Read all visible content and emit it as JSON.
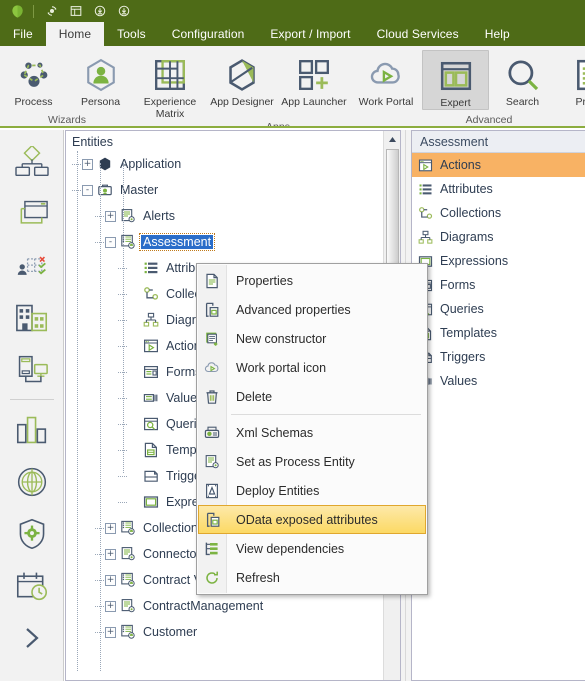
{
  "titlebar": {
    "icons": [
      "app-logo-icon",
      "refresh-circle-icon",
      "window-layout-icon",
      "download-circle-icon",
      "download-circle-alt-icon"
    ]
  },
  "menu": {
    "tabs": [
      {
        "label": "File",
        "active": false
      },
      {
        "label": "Home",
        "active": true
      },
      {
        "label": "Tools",
        "active": false
      },
      {
        "label": "Configuration",
        "active": false
      },
      {
        "label": "Export / Import",
        "active": false
      },
      {
        "label": "Cloud Services",
        "active": false
      },
      {
        "label": "Help",
        "active": false
      }
    ]
  },
  "ribbon": {
    "groups": [
      {
        "label": "Wizards",
        "items": [
          {
            "label": "Process",
            "icon": "process-nodes-icon",
            "selected": false
          },
          {
            "label": "Persona",
            "icon": "persona-icon",
            "selected": false
          }
        ]
      },
      {
        "label": "Apps",
        "items": [
          {
            "label": "Experience Matrix",
            "icon": "experience-matrix-icon",
            "selected": false
          },
          {
            "label": "App Designer",
            "icon": "app-designer-icon",
            "selected": false
          },
          {
            "label": "App Launcher",
            "icon": "app-launcher-icon",
            "selected": false
          },
          {
            "label": "Work Portal",
            "icon": "work-portal-icon",
            "selected": false
          }
        ]
      },
      {
        "label": "Advanced",
        "items": [
          {
            "label": "Expert",
            "icon": "expert-icon",
            "selected": true
          },
          {
            "label": "Search",
            "icon": "search-icon",
            "selected": false
          }
        ]
      },
      {
        "label": "",
        "items": [
          {
            "label": "Prope",
            "icon": "properties-doc-icon",
            "selected": false
          }
        ]
      }
    ]
  },
  "rail": {
    "items": [
      {
        "name": "org-chart-icon"
      },
      {
        "name": "window-forms-icon"
      },
      {
        "name": "user-tasks-icon"
      },
      {
        "name": "buildings-icon"
      },
      {
        "name": "devices-icon"
      },
      {
        "divider": true
      },
      {
        "name": "bar-chart-icon"
      },
      {
        "name": "globe-icon"
      },
      {
        "name": "shield-gear-icon"
      },
      {
        "name": "calendar-clock-icon"
      },
      {
        "name": "expand-chevron-icon"
      }
    ]
  },
  "tree": {
    "title": "Entities",
    "nodes": [
      {
        "label": "Application",
        "depth": 0,
        "expander": "+",
        "icon": "hexagon-solid-icon",
        "selected": false
      },
      {
        "label": "Master",
        "depth": 0,
        "expander": "-",
        "icon": "briefcase-icon",
        "selected": false
      },
      {
        "label": "Alerts",
        "depth": 1,
        "expander": "+",
        "icon": "entity-alert-icon",
        "selected": false
      },
      {
        "label": "Assessment",
        "depth": 1,
        "expander": "-",
        "icon": "entity-master-icon",
        "selected": true
      },
      {
        "label": "Attributes",
        "depth": 2,
        "expander": "",
        "icon": "attributes-icon",
        "selected": false
      },
      {
        "label": "Collections",
        "depth": 2,
        "expander": "",
        "icon": "collections-icon",
        "selected": false
      },
      {
        "label": "Diagrams",
        "depth": 2,
        "expander": "",
        "icon": "diagrams-icon",
        "selected": false
      },
      {
        "label": "Actions",
        "depth": 2,
        "expander": "",
        "icon": "actions-icon",
        "selected": false
      },
      {
        "label": "Forms",
        "depth": 2,
        "expander": "",
        "icon": "forms-icon",
        "selected": false
      },
      {
        "label": "Values",
        "depth": 2,
        "expander": "",
        "icon": "values-icon",
        "selected": false
      },
      {
        "label": "Queries",
        "depth": 2,
        "expander": "",
        "icon": "queries-icon",
        "selected": false
      },
      {
        "label": "Templates",
        "depth": 2,
        "expander": "",
        "icon": "templates-icon",
        "selected": false
      },
      {
        "label": "Triggers",
        "depth": 2,
        "expander": "",
        "icon": "triggers-icon",
        "selected": false
      },
      {
        "label": "Expressions",
        "depth": 2,
        "expander": "",
        "icon": "expressions-icon",
        "selected": false
      },
      {
        "label": "Collections",
        "depth": 1,
        "expander": "+",
        "icon": "entity-master-icon",
        "selected": false
      },
      {
        "label": "Connectors",
        "depth": 1,
        "expander": "+",
        "icon": "entity-alert-icon",
        "selected": false
      },
      {
        "label": "Contract Version",
        "depth": 1,
        "expander": "+",
        "icon": "entity-master-icon",
        "selected": false
      },
      {
        "label": "ContractManagement",
        "depth": 1,
        "expander": "+",
        "icon": "entity-alert-icon",
        "selected": false
      },
      {
        "label": "Customer",
        "depth": 1,
        "expander": "+",
        "icon": "entity-master-icon",
        "selected": false
      }
    ]
  },
  "right_panel": {
    "header": "Assessment",
    "items": [
      {
        "label": "Actions",
        "icon": "actions-icon",
        "active": true
      },
      {
        "label": "Attributes",
        "icon": "attributes-icon",
        "active": false
      },
      {
        "label": "Collections",
        "icon": "collections-icon",
        "active": false
      },
      {
        "label": "Diagrams",
        "icon": "diagrams-icon",
        "active": false
      },
      {
        "label": "Expressions",
        "icon": "expressions-icon",
        "active": false
      },
      {
        "label": "Forms",
        "icon": "forms-icon",
        "active": false
      },
      {
        "label": "Queries",
        "icon": "queries-icon",
        "active": false
      },
      {
        "label": "Templates",
        "icon": "templates-icon",
        "active": false
      },
      {
        "label": "Triggers",
        "icon": "triggers-icon",
        "active": false
      },
      {
        "label": "Values",
        "icon": "values-icon",
        "active": false
      }
    ]
  },
  "context_menu": {
    "items": [
      {
        "label": "Properties",
        "icon": "document-icon",
        "highlighted": false,
        "separator_after": false
      },
      {
        "label": "Advanced properties",
        "icon": "document-advanced-icon",
        "highlighted": false,
        "separator_after": false
      },
      {
        "label": "New constructor",
        "icon": "new-constructor-icon",
        "highlighted": false,
        "separator_after": false
      },
      {
        "label": "Work portal icon",
        "icon": "work-portal-icon",
        "highlighted": false,
        "separator_after": false
      },
      {
        "label": "Delete",
        "icon": "trash-icon",
        "highlighted": false,
        "separator_after": true
      },
      {
        "label": "Xml Schemas",
        "icon": "xml-schemas-icon",
        "highlighted": false,
        "separator_after": false
      },
      {
        "label": "Set as Process Entity",
        "icon": "process-entity-icon",
        "highlighted": false,
        "separator_after": false
      },
      {
        "label": "Deploy Entities",
        "icon": "deploy-entities-icon",
        "highlighted": false,
        "separator_after": false
      },
      {
        "label": "OData exposed attributes",
        "icon": "odata-icon",
        "highlighted": true,
        "separator_after": false
      },
      {
        "label": "View dependencies",
        "icon": "view-dependencies-icon",
        "highlighted": false,
        "separator_after": false
      },
      {
        "label": "Refresh",
        "icon": "refresh-icon",
        "highlighted": false,
        "separator_after": false
      }
    ]
  },
  "colors": {
    "brand_dark_green": "#4e6b17",
    "brand_light_green": "#8cad3f",
    "selection_blue": "#2a6dc9",
    "highlight_orange": "#f8b264",
    "menu_highlight_yellow": "#fcd964",
    "navy": "#3b4a60"
  }
}
